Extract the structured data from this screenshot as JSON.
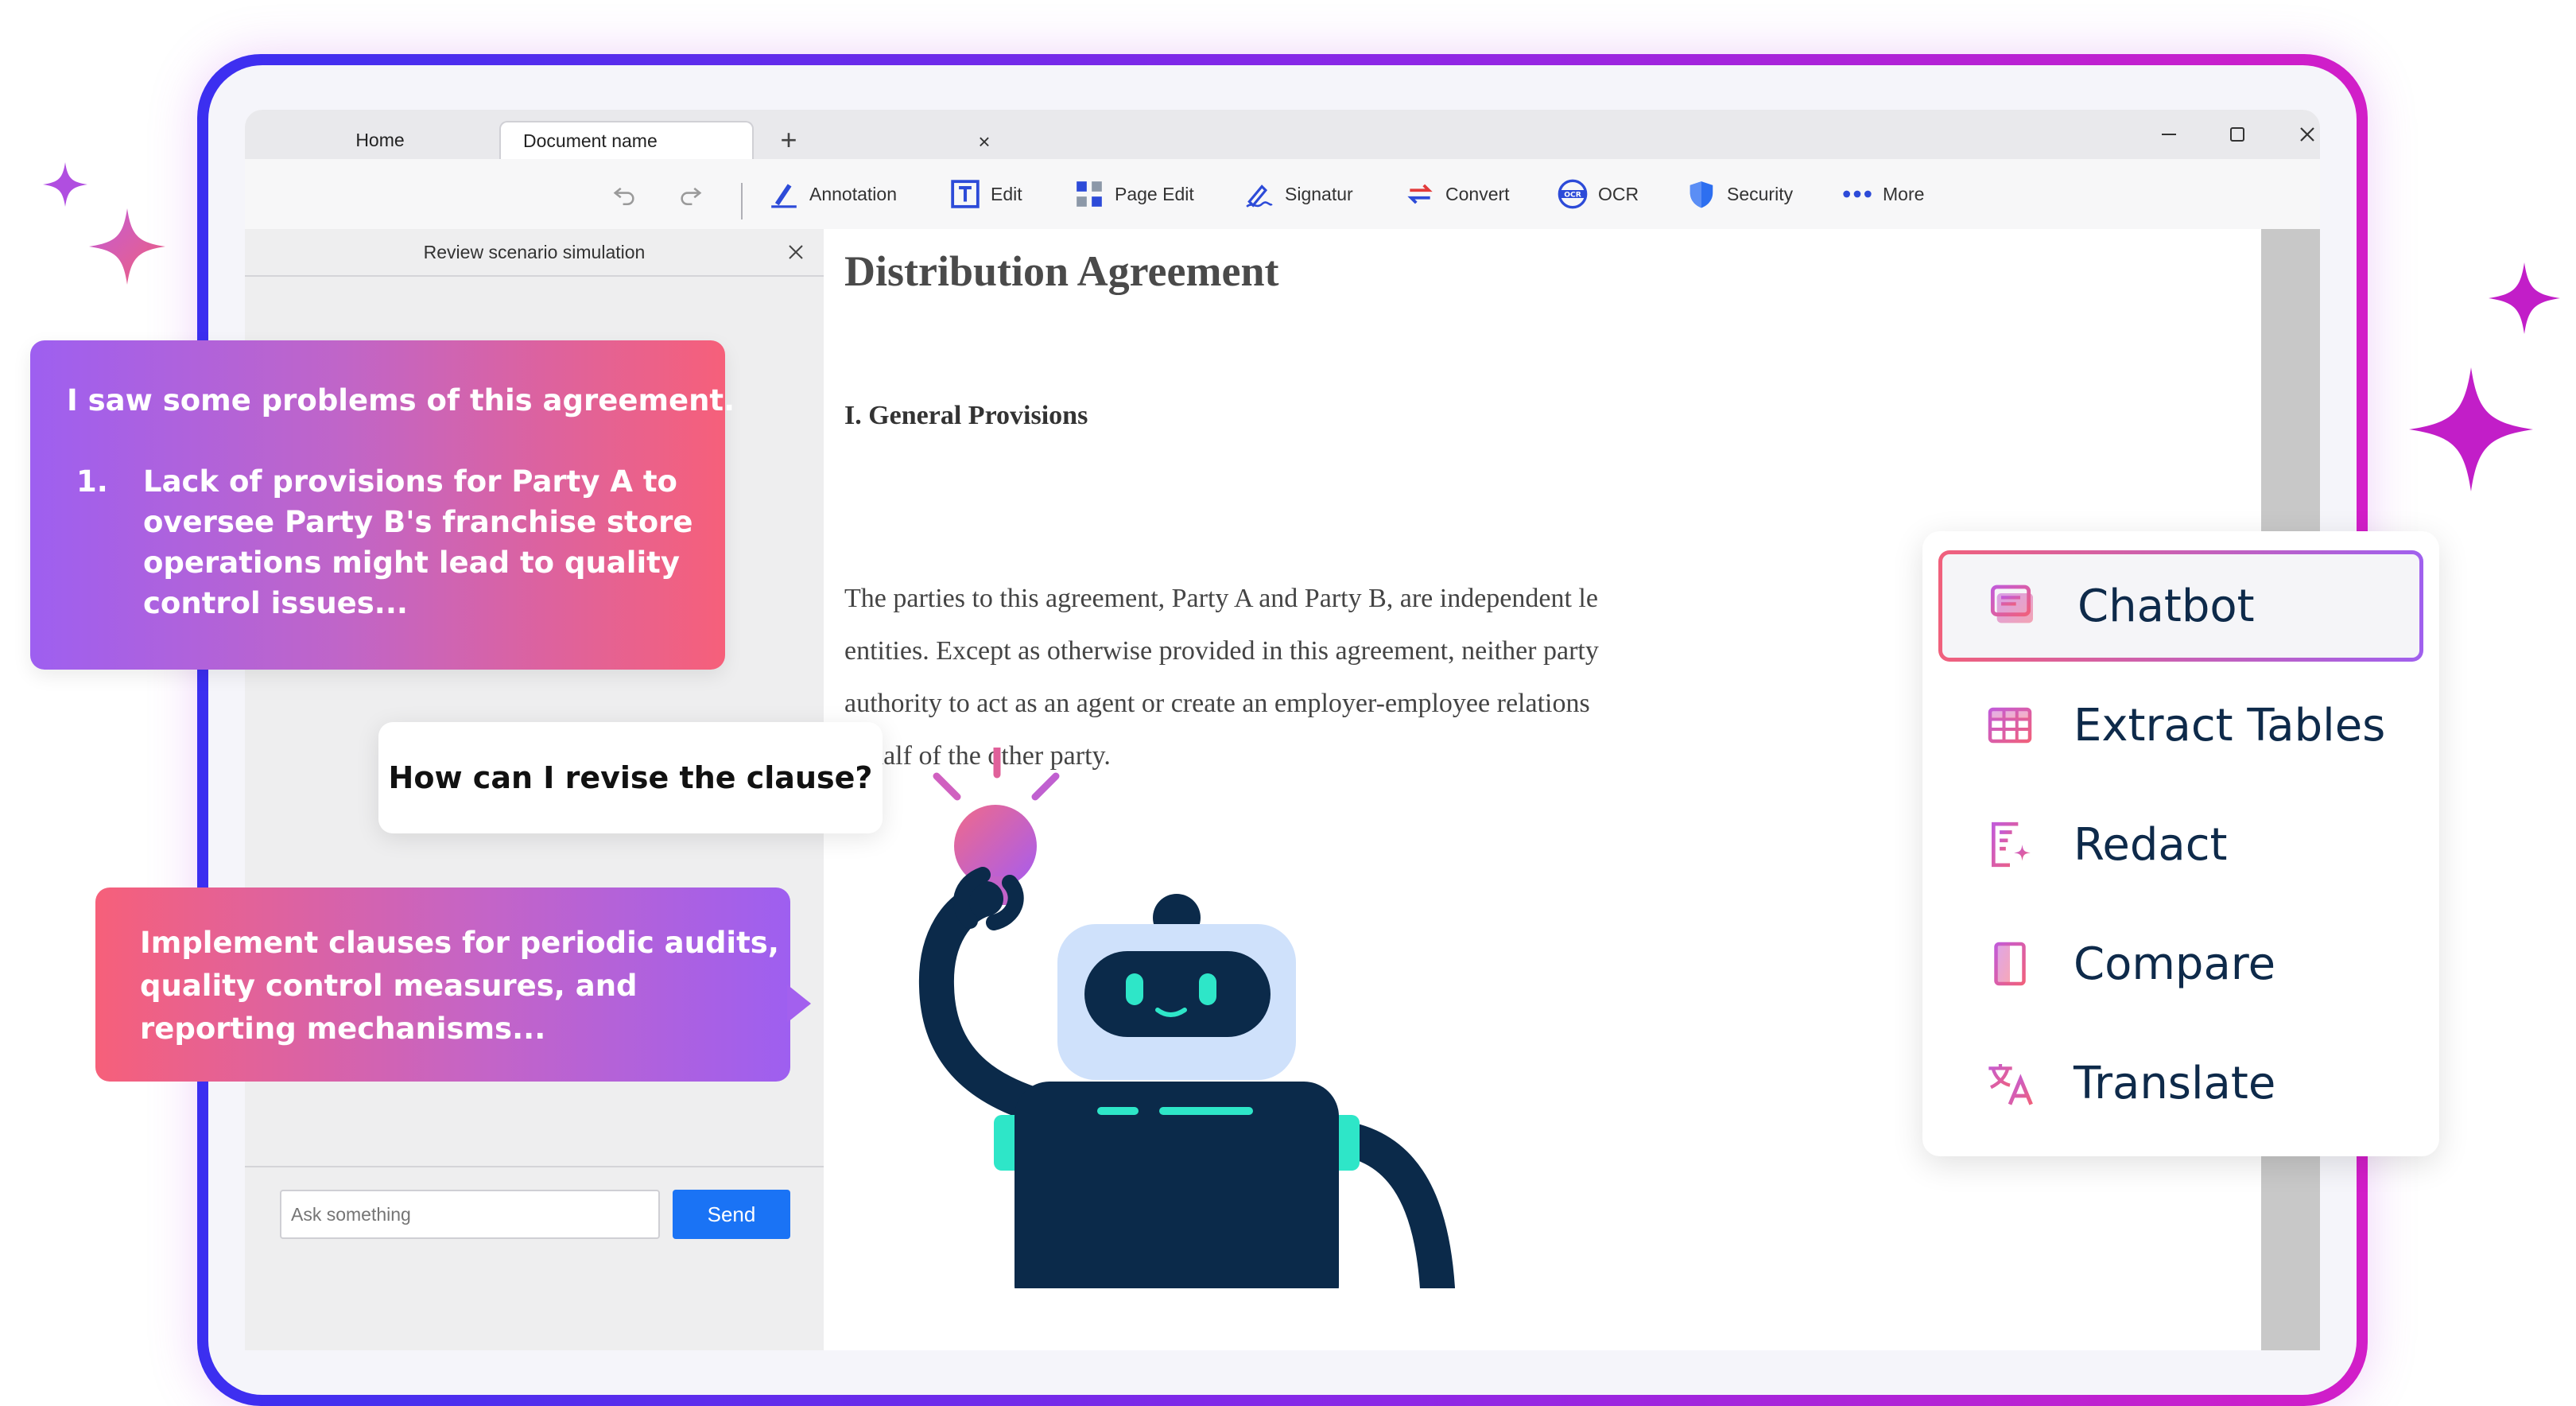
{
  "tabs": {
    "home": "Home",
    "document": "Document name",
    "close_glyph": "×",
    "add_glyph": "+"
  },
  "window_controls": {
    "minimize": "–",
    "maximize": "□",
    "close": "✕"
  },
  "toolbar": {
    "items": [
      {
        "label": "Annotation",
        "icon": "pen-icon"
      },
      {
        "label": "Edit",
        "icon": "text-edit-icon"
      },
      {
        "label": "Page Edit",
        "icon": "grid-icon"
      },
      {
        "label": "Signatur",
        "icon": "signature-icon"
      },
      {
        "label": "Convert",
        "icon": "convert-icon"
      },
      {
        "label": "OCR",
        "icon": "ocr-icon"
      },
      {
        "label": "Security",
        "icon": "shield-icon"
      },
      {
        "label": "More",
        "icon": "more-dots-icon"
      }
    ]
  },
  "sidebar": {
    "title": "Review scenario simulation",
    "close_glyph": "✕",
    "input_placeholder": "Ask something",
    "send_label": "Send"
  },
  "document": {
    "title": "Distribution Agreement",
    "section_heading": "I. General Provisions",
    "paragraph_lines": [
      "The parties to this agreement, Party A and Party B, are independent le",
      "entities. Except as otherwise provided in this agreement, neither party",
      "authority to act as an agent or create an employer-employee relations",
      "behalf of the other party."
    ]
  },
  "chat": {
    "ai_message_1": {
      "intro": "I saw some problems of this agreement.",
      "item_number": "1.",
      "item_lines": [
        "Lack of provisions for Party A to",
        "oversee Party B's franchise store",
        "operations might lead to quality",
        "control issues..."
      ]
    },
    "user_message": "How can I revise the clause?",
    "ai_message_2": {
      "lines": [
        "Implement clauses for periodic audits,",
        "quality control measures, and",
        "reporting mechanisms..."
      ]
    }
  },
  "feature_menu": {
    "items": [
      {
        "label": "Chatbot",
        "icon": "chatbot-icon",
        "active": true
      },
      {
        "label": "Extract Tables",
        "icon": "table-icon",
        "active": false
      },
      {
        "label": "Redact",
        "icon": "redact-icon",
        "active": false
      },
      {
        "label": "Compare",
        "icon": "compare-icon",
        "active": false
      },
      {
        "label": "Translate",
        "icon": "translate-icon",
        "active": false
      }
    ]
  },
  "colors": {
    "frame_gradient": [
      "#3b2ff0",
      "#d21ec8"
    ],
    "accent_pink": "#f6607a",
    "accent_purple": "#9e5ff0",
    "send_button": "#1a73f5",
    "robot_navy": "#0b2a4a",
    "robot_teal": "#2ee6c8"
  }
}
